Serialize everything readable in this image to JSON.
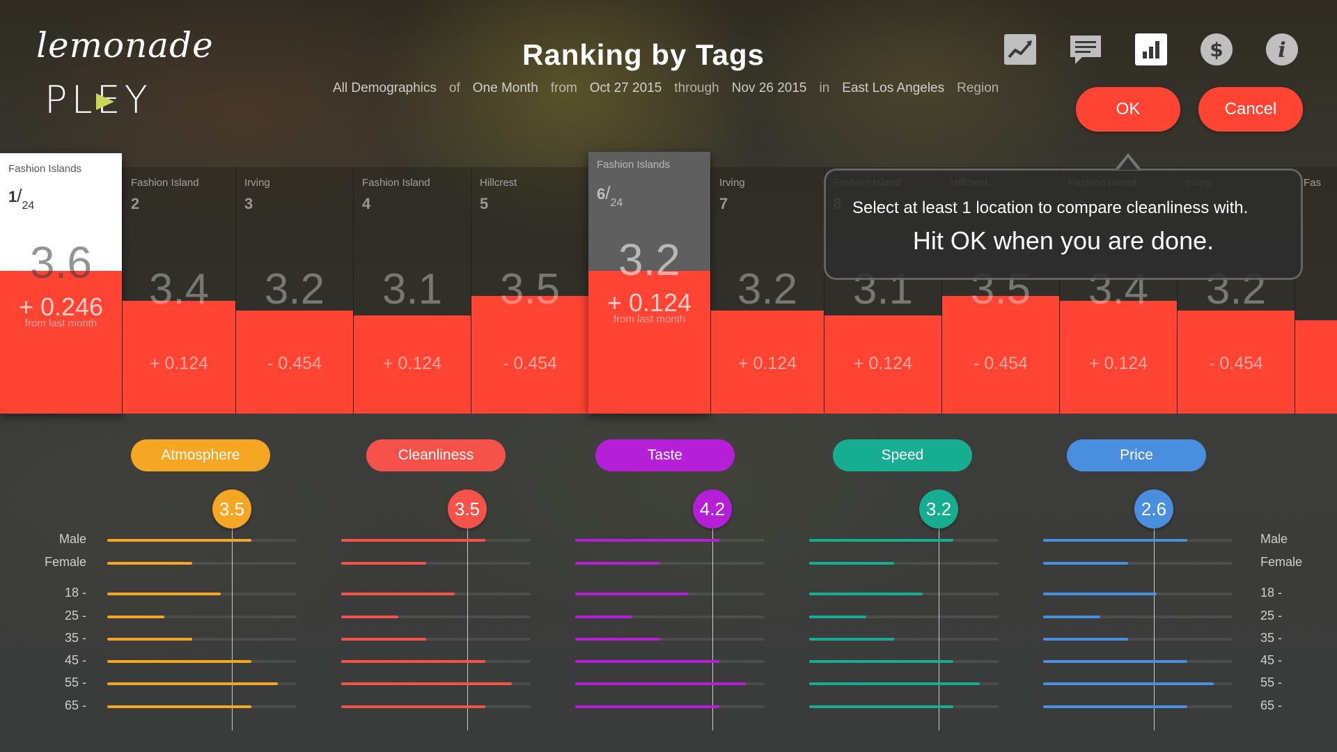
{
  "app": {
    "script_name": "lemonade",
    "name": "PLEY"
  },
  "header": {
    "title": "Ranking by Tags",
    "filters": [
      {
        "text": "All Demographics",
        "type": "value"
      },
      {
        "text": "of",
        "type": "conn"
      },
      {
        "text": "One Month",
        "type": "value"
      },
      {
        "text": "from",
        "type": "conn"
      },
      {
        "text": "Oct 27 2015",
        "type": "value"
      },
      {
        "text": "through",
        "type": "conn"
      },
      {
        "text": "Nov 26 2015",
        "type": "value"
      },
      {
        "text": "in",
        "type": "conn"
      },
      {
        "text": "East Los Angeles",
        "type": "value"
      },
      {
        "text": "Region",
        "type": "conn"
      }
    ]
  },
  "toolbar": {
    "icons": [
      "trend-icon",
      "comments-icon",
      "bar-chart-icon",
      "dollar-icon",
      "info-icon"
    ],
    "ok_label": "OK",
    "cancel_label": "Cancel"
  },
  "tooltip": {
    "line1": "Select at least 1 location to compare cleanliness with.",
    "line2": "Hit OK when you are done."
  },
  "ranking": {
    "from_label": "from last month",
    "rank_denominator": "24",
    "columns": [
      {
        "location": "Fashion Islands",
        "rank": "1",
        "score": "3.6",
        "delta": "+ 0.246",
        "score_value": 3.6,
        "highlight": "white"
      },
      {
        "location": "Fashion Island",
        "rank": "2",
        "score": "3.4",
        "delta": "+ 0.124",
        "score_value": 3.4
      },
      {
        "location": "Irving",
        "rank": "3",
        "score": "3.2",
        "delta": "- 0.454",
        "score_value": 3.2
      },
      {
        "location": "Fashion Island",
        "rank": "4",
        "score": "3.1",
        "delta": "+ 0.124",
        "score_value": 3.1
      },
      {
        "location": "Hillcrest",
        "rank": "5",
        "score": "3.5",
        "delta": "- 0.454",
        "score_value": 3.5
      },
      {
        "location": "Fashion Islands",
        "rank": "6",
        "score": "3.2",
        "delta": "+ 0.124",
        "score_value": 3.2,
        "highlight": "grey"
      },
      {
        "location": "Irving",
        "rank": "7",
        "score": "3.2",
        "delta": "+ 0.124",
        "score_value": 3.2
      },
      {
        "location": "Fashion Island",
        "rank": "8",
        "score": "3.1",
        "delta": "+ 0.124",
        "score_value": 3.1
      },
      {
        "location": "Hillcrest",
        "rank": "",
        "score": "3.5",
        "delta": "- 0.454",
        "score_value": 3.5
      },
      {
        "location": "Fashion Island",
        "rank": "",
        "score": "3.4",
        "delta": "+ 0.124",
        "score_value": 3.4
      },
      {
        "location": "Irving",
        "rank": "",
        "score": "3.2",
        "delta": "- 0.454",
        "score_value": 3.2
      },
      {
        "location": "Fas",
        "rank": "",
        "score": "",
        "delta": "",
        "score_value": 3.0
      }
    ]
  },
  "demographics": {
    "row_labels": [
      "Male",
      "Female",
      "18 -",
      "25 -",
      "35 -",
      "45 -",
      "55 -",
      "65 -"
    ],
    "categories": [
      {
        "name": "Atmosphere",
        "score": "3.5",
        "color": "#f5a623",
        "values": [
          0.76,
          0.45,
          0.6,
          0.3,
          0.45,
          0.76,
          0.9,
          0.76
        ]
      },
      {
        "name": "Cleanliness",
        "score": "3.5",
        "color": "#f5534a",
        "values": [
          0.76,
          0.45,
          0.6,
          0.3,
          0.45,
          0.76,
          0.9,
          0.76
        ]
      },
      {
        "name": "Taste",
        "score": "4.2",
        "color": "#b51fd8",
        "values": [
          0.76,
          0.45,
          0.6,
          0.3,
          0.45,
          0.76,
          0.9,
          0.76
        ]
      },
      {
        "name": "Speed",
        "score": "3.2",
        "color": "#17ad91",
        "values": [
          0.76,
          0.45,
          0.6,
          0.3,
          0.45,
          0.76,
          0.9,
          0.76
        ]
      },
      {
        "name": "Price",
        "score": "2.6",
        "color": "#4a8ee0",
        "values": [
          0.76,
          0.45,
          0.6,
          0.3,
          0.45,
          0.76,
          0.9,
          0.76
        ]
      }
    ]
  }
}
